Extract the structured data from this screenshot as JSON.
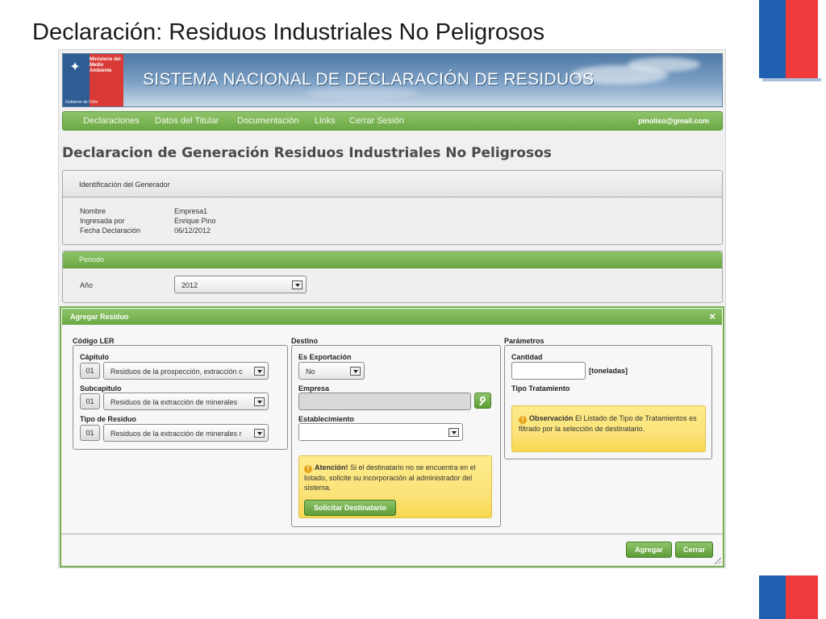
{
  "slide": {
    "title": "Declaración: Residuos Industriales No Peligrosos",
    "colors": {
      "flag_blue": "#1f5fb0",
      "flag_red": "#ef3b3b"
    }
  },
  "banner": {
    "ministry": "Ministerio del Medio Ambiente",
    "government": "Gobierno de Chile",
    "title": "SISTEMA NACIONAL DE DECLARACIÓN DE RESIDUOS",
    "icon": "coat-of-arms-icon"
  },
  "nav": {
    "items": [
      "Declaraciones",
      "Datos del Titular",
      "Documentación",
      "Links",
      "Cerrar Sesión"
    ],
    "email": "pinoliso@gmail.com",
    "accent_color": "#6aa843"
  },
  "page": {
    "heading": "Declaracion de Generación Residuos Industriales No Peligrosos"
  },
  "generador": {
    "title": "Identificación del Generador",
    "fields": [
      {
        "label": "Nombre",
        "value": "Empresa1"
      },
      {
        "label": "Ingresada por",
        "value": "Enrique Pino"
      },
      {
        "label": "Fecha Declaración",
        "value": "06/12/2012"
      }
    ]
  },
  "periodo": {
    "title": "Periodo",
    "year_label": "Año",
    "year_value": "2012"
  },
  "dialog": {
    "title": "Agregar Residuo",
    "close": "×",
    "ler": {
      "title": "Código LER",
      "capitulo": {
        "label": "Cápitulo",
        "code": "01",
        "value": "Residuos de la prospección, extracción c"
      },
      "subcapitulo": {
        "label": "Subcapitulo",
        "code": "01",
        "value": "Residuos de la extracción de minerales"
      },
      "tipo": {
        "label": "Tipo de Residuo",
        "code": "01",
        "value": "Residuos de la extracción de minerales r"
      }
    },
    "destino": {
      "title": "Destino",
      "exportacion_label": "Es Exportación",
      "exportacion_value": "No",
      "empresa_label": "Empresa",
      "establecimiento_label": "Establecimiento",
      "alert_strong": "Atención!",
      "alert_text": "Si el destinatario no se encuentra en el listado, solicite su incorporación al administrador del sistema.",
      "solicitar_button": "Solicitar Destinatario"
    },
    "parametros": {
      "title": "Parámetros",
      "cantidad_label": "Cantidad",
      "unit": "[toneladas]",
      "tratamiento_label": "Tipo Tratamiento",
      "obs_strong": "Observación",
      "obs_text": "El Listado de Tipo de Tratamientos es filtrado por la selección de destinatario."
    },
    "buttons": {
      "agregar": "Agregar",
      "cerrar": "Cerrar"
    }
  }
}
